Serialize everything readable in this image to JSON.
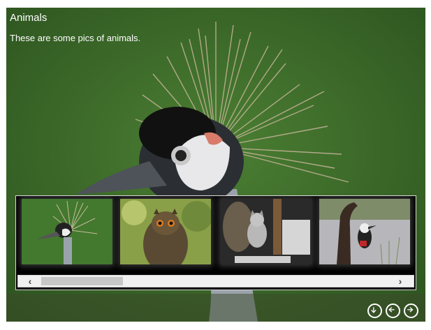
{
  "gallery": {
    "title": "Animals",
    "description": "These are some pics of animals."
  },
  "thumbnails": [
    {
      "icon": "crane-thumbnail"
    },
    {
      "icon": "owl-thumbnail"
    },
    {
      "icon": "cat-thumbnail"
    },
    {
      "icon": "woodpecker-thumbnail"
    }
  ],
  "scrollbar": {
    "left_arrow": "‹",
    "right_arrow": "›"
  },
  "nav": {
    "down": "down-arrow-icon",
    "prev": "left-arrow-icon",
    "next": "right-arrow-icon"
  },
  "colors": {
    "overlay_text": "#ffffff",
    "strip_bg": "#000000"
  }
}
